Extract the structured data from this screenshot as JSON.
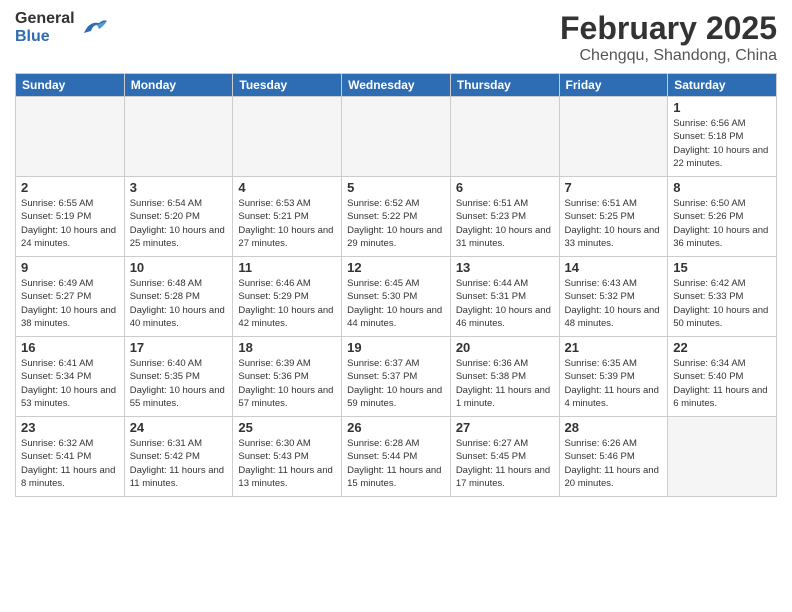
{
  "header": {
    "logo_general": "General",
    "logo_blue": "Blue",
    "month_title": "February 2025",
    "location": "Chengqu, Shandong, China"
  },
  "weekdays": [
    "Sunday",
    "Monday",
    "Tuesday",
    "Wednesday",
    "Thursday",
    "Friday",
    "Saturday"
  ],
  "weeks": [
    [
      {
        "day": "",
        "info": ""
      },
      {
        "day": "",
        "info": ""
      },
      {
        "day": "",
        "info": ""
      },
      {
        "day": "",
        "info": ""
      },
      {
        "day": "",
        "info": ""
      },
      {
        "day": "",
        "info": ""
      },
      {
        "day": "1",
        "info": "Sunrise: 6:56 AM\nSunset: 5:18 PM\nDaylight: 10 hours and 22 minutes."
      }
    ],
    [
      {
        "day": "2",
        "info": "Sunrise: 6:55 AM\nSunset: 5:19 PM\nDaylight: 10 hours and 24 minutes."
      },
      {
        "day": "3",
        "info": "Sunrise: 6:54 AM\nSunset: 5:20 PM\nDaylight: 10 hours and 25 minutes."
      },
      {
        "day": "4",
        "info": "Sunrise: 6:53 AM\nSunset: 5:21 PM\nDaylight: 10 hours and 27 minutes."
      },
      {
        "day": "5",
        "info": "Sunrise: 6:52 AM\nSunset: 5:22 PM\nDaylight: 10 hours and 29 minutes."
      },
      {
        "day": "6",
        "info": "Sunrise: 6:51 AM\nSunset: 5:23 PM\nDaylight: 10 hours and 31 minutes."
      },
      {
        "day": "7",
        "info": "Sunrise: 6:51 AM\nSunset: 5:25 PM\nDaylight: 10 hours and 33 minutes."
      },
      {
        "day": "8",
        "info": "Sunrise: 6:50 AM\nSunset: 5:26 PM\nDaylight: 10 hours and 36 minutes."
      }
    ],
    [
      {
        "day": "9",
        "info": "Sunrise: 6:49 AM\nSunset: 5:27 PM\nDaylight: 10 hours and 38 minutes."
      },
      {
        "day": "10",
        "info": "Sunrise: 6:48 AM\nSunset: 5:28 PM\nDaylight: 10 hours and 40 minutes."
      },
      {
        "day": "11",
        "info": "Sunrise: 6:46 AM\nSunset: 5:29 PM\nDaylight: 10 hours and 42 minutes."
      },
      {
        "day": "12",
        "info": "Sunrise: 6:45 AM\nSunset: 5:30 PM\nDaylight: 10 hours and 44 minutes."
      },
      {
        "day": "13",
        "info": "Sunrise: 6:44 AM\nSunset: 5:31 PM\nDaylight: 10 hours and 46 minutes."
      },
      {
        "day": "14",
        "info": "Sunrise: 6:43 AM\nSunset: 5:32 PM\nDaylight: 10 hours and 48 minutes."
      },
      {
        "day": "15",
        "info": "Sunrise: 6:42 AM\nSunset: 5:33 PM\nDaylight: 10 hours and 50 minutes."
      }
    ],
    [
      {
        "day": "16",
        "info": "Sunrise: 6:41 AM\nSunset: 5:34 PM\nDaylight: 10 hours and 53 minutes."
      },
      {
        "day": "17",
        "info": "Sunrise: 6:40 AM\nSunset: 5:35 PM\nDaylight: 10 hours and 55 minutes."
      },
      {
        "day": "18",
        "info": "Sunrise: 6:39 AM\nSunset: 5:36 PM\nDaylight: 10 hours and 57 minutes."
      },
      {
        "day": "19",
        "info": "Sunrise: 6:37 AM\nSunset: 5:37 PM\nDaylight: 10 hours and 59 minutes."
      },
      {
        "day": "20",
        "info": "Sunrise: 6:36 AM\nSunset: 5:38 PM\nDaylight: 11 hours and 1 minute."
      },
      {
        "day": "21",
        "info": "Sunrise: 6:35 AM\nSunset: 5:39 PM\nDaylight: 11 hours and 4 minutes."
      },
      {
        "day": "22",
        "info": "Sunrise: 6:34 AM\nSunset: 5:40 PM\nDaylight: 11 hours and 6 minutes."
      }
    ],
    [
      {
        "day": "23",
        "info": "Sunrise: 6:32 AM\nSunset: 5:41 PM\nDaylight: 11 hours and 8 minutes."
      },
      {
        "day": "24",
        "info": "Sunrise: 6:31 AM\nSunset: 5:42 PM\nDaylight: 11 hours and 11 minutes."
      },
      {
        "day": "25",
        "info": "Sunrise: 6:30 AM\nSunset: 5:43 PM\nDaylight: 11 hours and 13 minutes."
      },
      {
        "day": "26",
        "info": "Sunrise: 6:28 AM\nSunset: 5:44 PM\nDaylight: 11 hours and 15 minutes."
      },
      {
        "day": "27",
        "info": "Sunrise: 6:27 AM\nSunset: 5:45 PM\nDaylight: 11 hours and 17 minutes."
      },
      {
        "day": "28",
        "info": "Sunrise: 6:26 AM\nSunset: 5:46 PM\nDaylight: 11 hours and 20 minutes."
      },
      {
        "day": "",
        "info": ""
      }
    ]
  ]
}
